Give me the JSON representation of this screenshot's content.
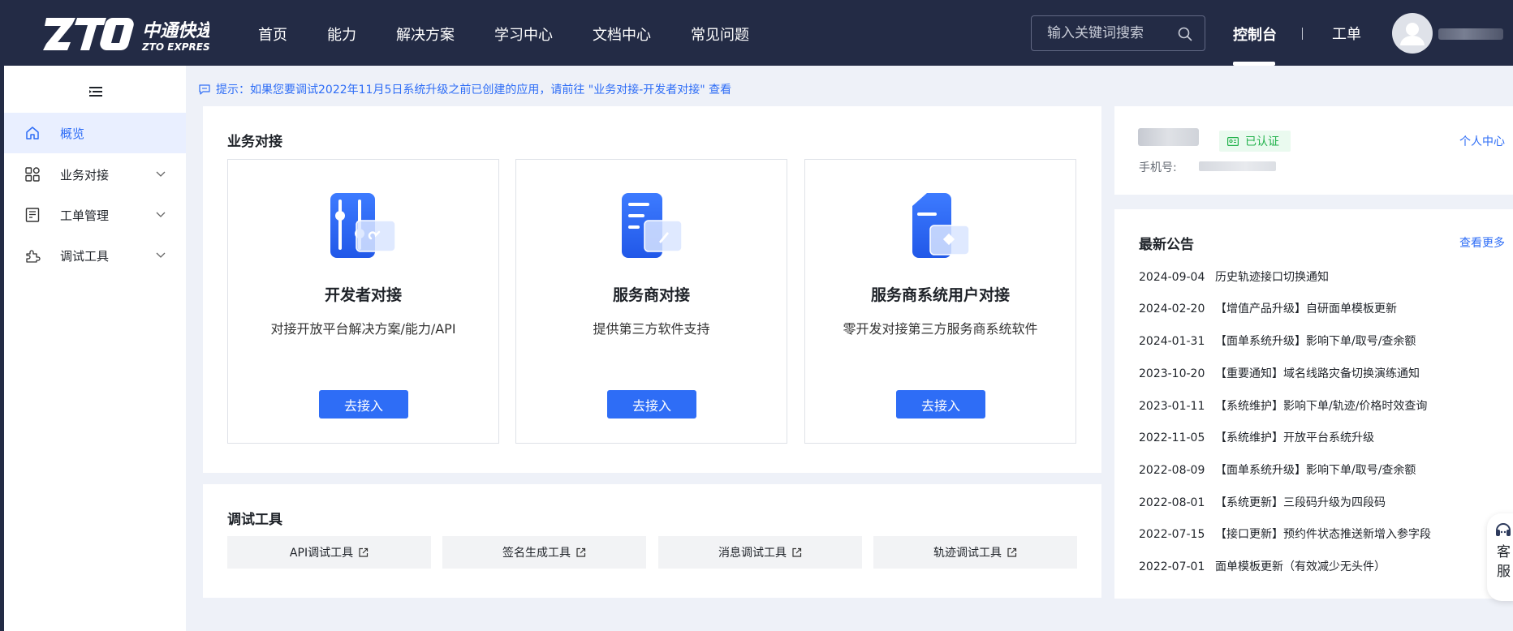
{
  "header": {
    "logo_cn": "中通快递",
    "logo_en": "ZTO EXPRESS",
    "nav": [
      {
        "label": "首页"
      },
      {
        "label": "能力"
      },
      {
        "label": "解决方案"
      },
      {
        "label": "学习中心"
      },
      {
        "label": "文档中心"
      },
      {
        "label": "常见问题"
      }
    ],
    "search_placeholder": "输入关键词搜索",
    "console_label": "控制台",
    "ticket_label": "工单"
  },
  "sidebar": {
    "items": [
      {
        "label": "概览",
        "icon": "home-icon",
        "active": true
      },
      {
        "label": "业务对接",
        "icon": "grid-icon"
      },
      {
        "label": "工单管理",
        "icon": "ticket-icon"
      },
      {
        "label": "调试工具",
        "icon": "puzzle-icon"
      }
    ]
  },
  "notice": {
    "text": "提示：如果您要调试2022年11月5日系统升级之前已创建的应用，请前往 \"业务对接-开发者对接\" 查看"
  },
  "business": {
    "title": "业务对接",
    "cards": [
      {
        "title": "开发者对接",
        "desc": "对接开放平台解决方案/能力/API",
        "button": "去接入",
        "icon": "developer-icon"
      },
      {
        "title": "服务商对接",
        "desc": "提供第三方软件支持",
        "button": "去接入",
        "icon": "service-provider-icon"
      },
      {
        "title": "服务商系统用户对接",
        "desc": "零开发对接第三方服务商系统软件",
        "button": "去接入",
        "icon": "system-user-icon"
      }
    ]
  },
  "tools": {
    "title": "调试工具",
    "items": [
      {
        "label": "API调试工具"
      },
      {
        "label": "签名生成工具"
      },
      {
        "label": "消息调试工具"
      },
      {
        "label": "轨迹调试工具"
      }
    ]
  },
  "profile": {
    "verified_label": "已认证",
    "personal_center_label": "个人中心",
    "phone_label": "手机号:"
  },
  "announcements": {
    "title": "最新公告",
    "more_label": "查看更多",
    "items": [
      {
        "date": "2024-09-04",
        "text": "历史轨迹接口切换通知"
      },
      {
        "date": "2024-02-20",
        "text": "【增值产品升级】自研面单模板更新"
      },
      {
        "date": "2024-01-31",
        "text": "【面单系统升级】影响下单/取号/查余额"
      },
      {
        "date": "2023-10-20",
        "text": "【重要通知】域名线路灾备切换演练通知"
      },
      {
        "date": "2023-01-11",
        "text": "【系统维护】影响下单/轨迹/价格时效查询"
      },
      {
        "date": "2022-11-05",
        "text": "【系统维护】开放平台系统升级"
      },
      {
        "date": "2022-08-09",
        "text": "【面单系统升级】影响下单/取号/查余额"
      },
      {
        "date": "2022-08-01",
        "text": "【系统更新】三段码升级为四段码"
      },
      {
        "date": "2022-07-15",
        "text": "【接口更新】预约件状态推送新增入参字段"
      },
      {
        "date": "2022-07-01",
        "text": "面单模板更新（有效减少无头件）"
      }
    ]
  },
  "customer_service": {
    "label_1": "客",
    "label_2": "服"
  },
  "colors": {
    "header_bg": "#232b45",
    "accent": "#2e6df6",
    "verified_green": "#22b24c",
    "page_bg": "#eef1f8"
  }
}
